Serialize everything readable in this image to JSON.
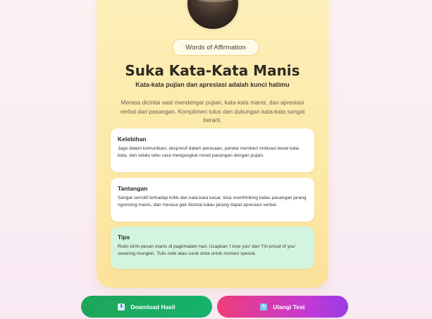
{
  "result": {
    "badge": "Words of Affirmation",
    "title": "Suka Kata-Kata Manis",
    "subtitle": "Kata-kata pujian dan apresiasi adalah kunci hatimu",
    "description": "Merasa dicintai saat mendengar pujian, kata-kata manis, dan apresiasi verbal dari pasangan. Komplimen tulus dan dukungan kata-kata sangat berarti."
  },
  "sections": [
    {
      "heading": "Kelebihan",
      "text": "Jago dalam komunikasi, ekspresif dalam perasaan, pandai memberi motivasi lewat kata-kata, dan selalu tahu cara mengangkat mood pasangan dengan pujian."
    },
    {
      "heading": "Tantangan",
      "text": "Sangat sensitif terhadap kritik dan kata-kata kasar, bisa overthinking kalau pasangan jarang ngomong manis, dan merasa gak dicintai kalau jarang dapat apresiasi verbal."
    },
    {
      "heading": "Tips",
      "text": "Rutin kirim pesan manis di pagi/malam hari. Ucapkan 'I love you' dan 'I'm proud of you' sesering mungkin. Tulis note atau surat cinta untuk momen spesial."
    }
  ],
  "actions": {
    "download_label": "Download Hasil",
    "download_icon": "download-icon",
    "retry_label": "Ulangi Test",
    "retry_icon": "refresh-icon"
  },
  "colors": {
    "card": "#fde9a6",
    "tips_box": "#d3f5df",
    "download_button": "#1fa65a",
    "retry_button_start": "#ef3d7a",
    "retry_button_end": "#9a3be6"
  }
}
